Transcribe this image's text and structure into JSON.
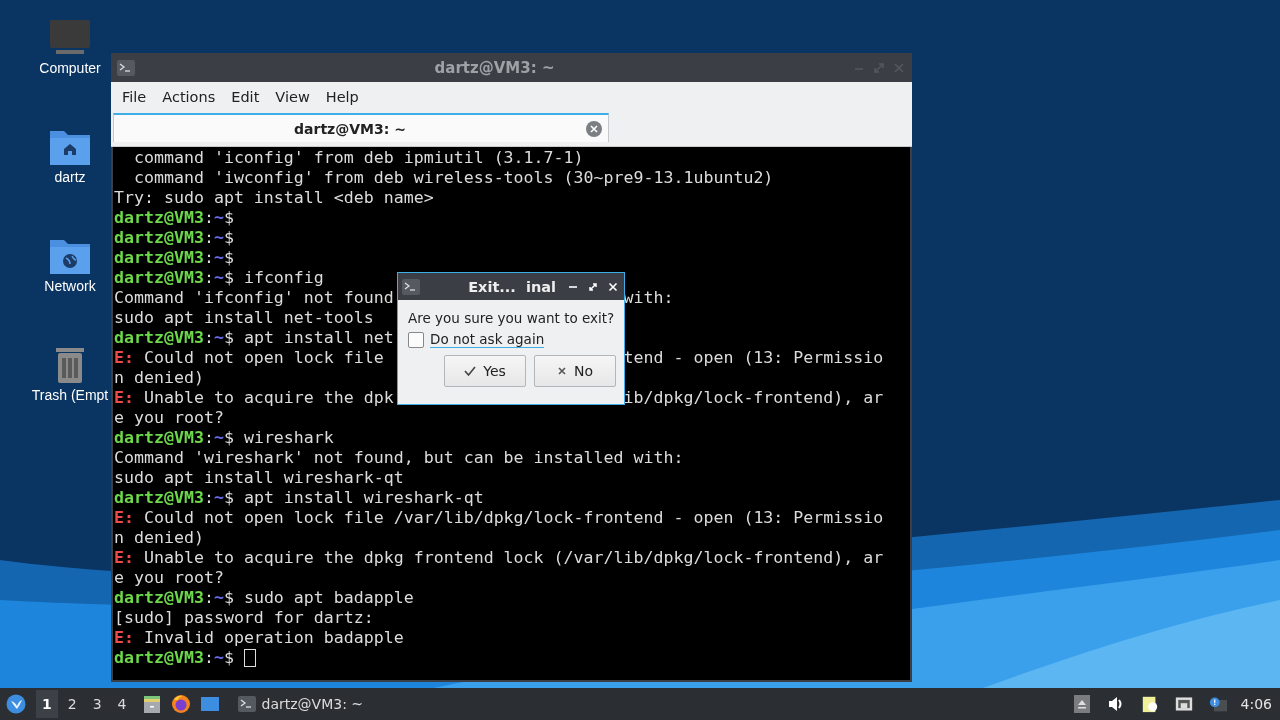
{
  "desktop_icons": [
    {
      "kind": "computer",
      "label": "Computer"
    },
    {
      "kind": "home-folder",
      "label": "dartz"
    },
    {
      "kind": "network-folder",
      "label": "Network"
    },
    {
      "kind": "trash",
      "label": "Trash (Empt"
    }
  ],
  "terminal_window": {
    "title": "dartz@VM3: ~",
    "menu": [
      "File",
      "Actions",
      "Edit",
      "View",
      "Help"
    ],
    "tabs": [
      {
        "label": "dartz@VM3: ~",
        "selected": true
      }
    ],
    "lines": [
      {
        "segments": [
          {
            "kind": "plain",
            "text": "  command 'iconfig' from deb ipmiutil (3.1.7-1)"
          }
        ]
      },
      {
        "segments": [
          {
            "kind": "plain",
            "text": "  command 'iwconfig' from deb wireless-tools (30~pre9-13.1ubuntu2)"
          }
        ]
      },
      {
        "segments": [
          {
            "kind": "plain",
            "text": "Try: sudo apt install <deb name>"
          }
        ]
      },
      {
        "segments": [
          {
            "kind": "user",
            "text": "dartz@VM3"
          },
          {
            "kind": "plain",
            "text": ":"
          },
          {
            "kind": "path",
            "text": "~"
          },
          {
            "kind": "plain",
            "text": "$"
          }
        ]
      },
      {
        "segments": [
          {
            "kind": "user",
            "text": "dartz@VM3"
          },
          {
            "kind": "plain",
            "text": ":"
          },
          {
            "kind": "path",
            "text": "~"
          },
          {
            "kind": "plain",
            "text": "$"
          }
        ]
      },
      {
        "segments": [
          {
            "kind": "user",
            "text": "dartz@VM3"
          },
          {
            "kind": "plain",
            "text": ":"
          },
          {
            "kind": "path",
            "text": "~"
          },
          {
            "kind": "plain",
            "text": "$"
          }
        ]
      },
      {
        "segments": [
          {
            "kind": "user",
            "text": "dartz@VM3"
          },
          {
            "kind": "plain",
            "text": ":"
          },
          {
            "kind": "path",
            "text": "~"
          },
          {
            "kind": "plain",
            "text": "$ ifconfig"
          }
        ]
      },
      {
        "segments": [
          {
            "kind": "plain",
            "text": "Command 'ifconfig' not found"
          }
        ],
        "after_dialog": [
          {
            "kind": "plain",
            "text": "with:"
          }
        ]
      },
      {
        "segments": [
          {
            "kind": "plain",
            "text": "sudo apt install net-tools"
          }
        ]
      },
      {
        "segments": [
          {
            "kind": "user",
            "text": "dartz@VM3"
          },
          {
            "kind": "plain",
            "text": ":"
          },
          {
            "kind": "path",
            "text": "~"
          },
          {
            "kind": "plain",
            "text": "$ apt install net"
          }
        ]
      },
      {
        "segments": [
          {
            "kind": "error",
            "text": "E:"
          },
          {
            "kind": "plain",
            "text": " Could not open lock file"
          }
        ],
        "after_dialog": [
          {
            "kind": "plain",
            "text": "tend - open (13: Permissio"
          }
        ]
      },
      {
        "segments": [
          {
            "kind": "plain",
            "text": "n denied)"
          }
        ]
      },
      {
        "segments": [
          {
            "kind": "error",
            "text": "E:"
          },
          {
            "kind": "plain",
            "text": " Unable to acquire the dpk"
          }
        ],
        "after_dialog": [
          {
            "kind": "plain",
            "text": "ib/dpkg/lock-frontend), ar"
          }
        ]
      },
      {
        "segments": [
          {
            "kind": "plain",
            "text": "e you root?"
          }
        ]
      },
      {
        "segments": [
          {
            "kind": "user",
            "text": "dartz@VM3"
          },
          {
            "kind": "plain",
            "text": ":"
          },
          {
            "kind": "path",
            "text": "~"
          },
          {
            "kind": "plain",
            "text": "$ wireshark"
          }
        ]
      },
      {
        "segments": [
          {
            "kind": "plain",
            "text": "Command 'wireshark' not found, but can be installed with:"
          }
        ]
      },
      {
        "segments": [
          {
            "kind": "plain",
            "text": "sudo apt install wireshark-qt"
          }
        ]
      },
      {
        "segments": [
          {
            "kind": "user",
            "text": "dartz@VM3"
          },
          {
            "kind": "plain",
            "text": ":"
          },
          {
            "kind": "path",
            "text": "~"
          },
          {
            "kind": "plain",
            "text": "$ apt install wireshark-qt"
          }
        ]
      },
      {
        "segments": [
          {
            "kind": "error",
            "text": "E:"
          },
          {
            "kind": "plain",
            "text": " Could not open lock file /var/lib/dpkg/lock-frontend - open (13: Permissio"
          }
        ]
      },
      {
        "segments": [
          {
            "kind": "plain",
            "text": "n denied)"
          }
        ]
      },
      {
        "segments": [
          {
            "kind": "error",
            "text": "E:"
          },
          {
            "kind": "plain",
            "text": " Unable to acquire the dpkg frontend lock (/var/lib/dpkg/lock-frontend), ar"
          }
        ]
      },
      {
        "segments": [
          {
            "kind": "plain",
            "text": "e you root?"
          }
        ]
      },
      {
        "segments": [
          {
            "kind": "user",
            "text": "dartz@VM3"
          },
          {
            "kind": "plain",
            "text": ":"
          },
          {
            "kind": "path",
            "text": "~"
          },
          {
            "kind": "plain",
            "text": "$ sudo apt badapple"
          }
        ]
      },
      {
        "segments": [
          {
            "kind": "plain",
            "text": "[sudo] password for dartz:"
          }
        ]
      },
      {
        "segments": [
          {
            "kind": "error",
            "text": "E:"
          },
          {
            "kind": "plain",
            "text": " Invalid operation badapple"
          }
        ]
      },
      {
        "segments": [
          {
            "kind": "user",
            "text": "dartz@VM3"
          },
          {
            "kind": "plain",
            "text": ":"
          },
          {
            "kind": "path",
            "text": "~"
          },
          {
            "kind": "plain",
            "text": "$"
          }
        ],
        "cursor": true
      }
    ]
  },
  "dialog": {
    "title": "Exit...  inal",
    "message": "Are you sure you want to exit?",
    "checkbox": {
      "label": "Do not ask again",
      "checked": false
    },
    "buttons": [
      {
        "kind": "yes",
        "label": "Yes"
      },
      {
        "kind": "no",
        "label": "No"
      }
    ]
  },
  "taskbar": {
    "workspaces": [
      {
        "label": "1",
        "selected": true
      },
      {
        "label": "2",
        "selected": false
      },
      {
        "label": "3",
        "selected": false
      },
      {
        "label": "4",
        "selected": false
      }
    ],
    "tasks": [
      {
        "label": "dartz@VM3: ~"
      }
    ],
    "clock": "4:06"
  }
}
